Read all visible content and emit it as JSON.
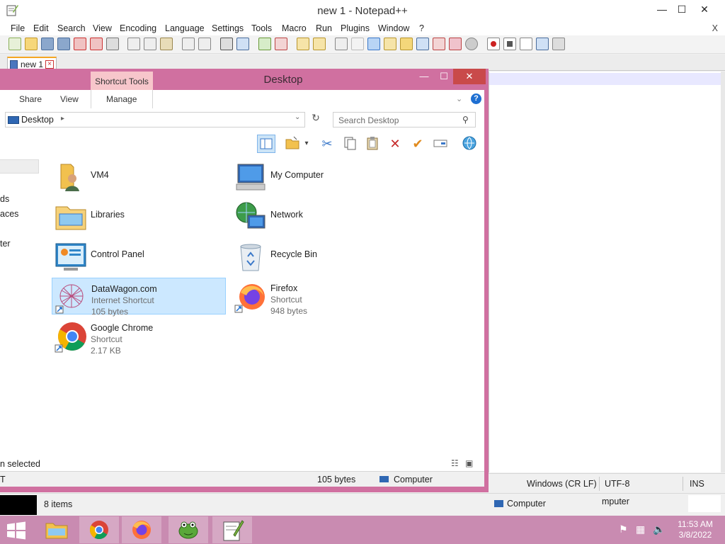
{
  "notepad": {
    "title": "new 1 - Notepad++",
    "window_controls": {
      "minimize": "—",
      "maximize": "☐",
      "close": "✕"
    },
    "menu": [
      "File",
      "Edit",
      "Search",
      "View",
      "Encoding",
      "Language",
      "Settings",
      "Tools",
      "Macro",
      "Run",
      "Plugins",
      "Window",
      "?"
    ],
    "menu_close": "X",
    "tab": {
      "label": "new 1"
    },
    "status": {
      "eol": "Windows (CR LF)",
      "encoding": "UTF-8",
      "mode": "INS"
    }
  },
  "explorer": {
    "title": "Desktop",
    "contextual_group": "Shortcut Tools",
    "ribbon_tabs": [
      "Share",
      "View",
      "Manage"
    ],
    "address": {
      "location": "Desktop"
    },
    "search": {
      "placeholder": "Search Desktop"
    },
    "nav_items": [
      "ds",
      "aces",
      "ter"
    ],
    "items": [
      {
        "name": "VM4",
        "icon": "user-folder-icon"
      },
      {
        "name": "My Computer",
        "icon": "computer-icon"
      },
      {
        "name": "Libraries",
        "icon": "libraries-icon"
      },
      {
        "name": "Network",
        "icon": "network-icon"
      },
      {
        "name": "Control Panel",
        "icon": "control-panel-icon"
      },
      {
        "name": "Recycle Bin",
        "icon": "recycle-bin-icon"
      },
      {
        "name": "DataWagon.com",
        "type": "Internet Shortcut",
        "size": "105 bytes",
        "icon": "datawagon-icon",
        "selected": true
      },
      {
        "name": "Firefox",
        "type": "Shortcut",
        "size": "948 bytes",
        "icon": "firefox-icon"
      },
      {
        "name": "Google Chrome",
        "type": "Shortcut",
        "size": "2.17 KB",
        "icon": "chrome-icon"
      }
    ],
    "status_selected": "n selected",
    "bottom": {
      "left": "T",
      "size": "105 bytes",
      "zone": "Computer"
    }
  },
  "other_window": {
    "items": "8 items",
    "zone": "Computer",
    "zone2": "mputer"
  },
  "taskbar": {
    "time": "11:53 AM",
    "date": "3/8/2022",
    "apps": [
      "file-explorer-icon",
      "chrome-icon",
      "firefox-icon",
      "frog-app-icon",
      "notepadpp-icon"
    ]
  },
  "colors": {
    "explorer_frame": "#d070a0",
    "taskbar": "#c98bb1",
    "context_tab": "#f7c6cb",
    "selection": "#cce8ff"
  }
}
